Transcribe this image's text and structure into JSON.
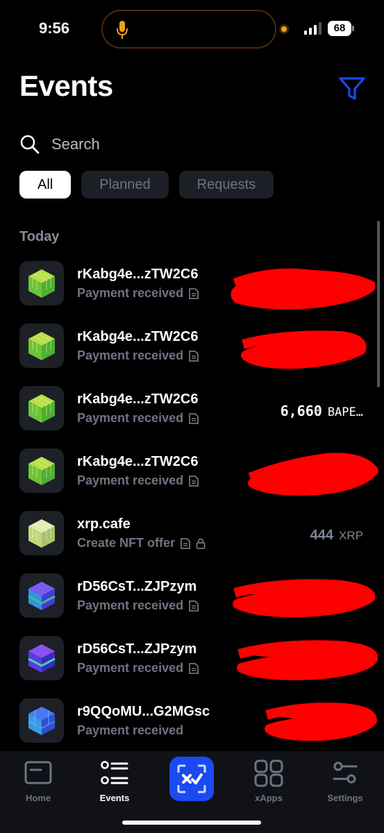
{
  "status_bar": {
    "time": "9:56",
    "battery": "68"
  },
  "header": {
    "title": "Events"
  },
  "search": {
    "placeholder": "Search"
  },
  "filters": [
    {
      "label": "All",
      "active": true
    },
    {
      "label": "Planned",
      "active": false
    },
    {
      "label": "Requests",
      "active": false
    }
  ],
  "section": {
    "label": "Today"
  },
  "events": [
    {
      "name": "rKabg4e...zTW2C6",
      "subtitle": "Payment received",
      "amount": "",
      "currency": "",
      "redacted": true,
      "avatar": "green"
    },
    {
      "name": "rKabg4e...zTW2C6",
      "subtitle": "Payment received",
      "amount": "",
      "currency": "",
      "redacted": true,
      "avatar": "green"
    },
    {
      "name": "rKabg4e...zTW2C6",
      "subtitle": "Payment received",
      "amount": "6,660",
      "currency": "BAPE…",
      "redacted": false,
      "avatar": "green"
    },
    {
      "name": "rKabg4e...zTW2C6",
      "subtitle": "Payment received",
      "amount": "",
      "currency": "",
      "redacted": true,
      "avatar": "green"
    },
    {
      "name": "xrp.cafe",
      "subtitle": "Create NFT offer",
      "amount": "444",
      "currency": "XRP",
      "redacted": false,
      "avatar": "pale",
      "lock": true
    },
    {
      "name": "rD56CsT...ZJPzym",
      "subtitle": "Payment received",
      "amount": "",
      "currency": "",
      "redacted": true,
      "avatar": "purple"
    },
    {
      "name": "rD56CsT...ZJPzym",
      "subtitle": "Payment received",
      "amount": "",
      "currency": "",
      "redacted": true,
      "avatar": "purple"
    },
    {
      "name": "r9QQoMU...G2MGsc",
      "subtitle": "Payment received",
      "amount": "",
      "currency": "",
      "redacted": true,
      "avatar": "blue"
    }
  ],
  "tabbar": {
    "home": "Home",
    "events": "Events",
    "xapps": "xApps",
    "settings": "Settings"
  },
  "colors": {
    "accent": "#1a4af0",
    "redaction": "#ff0000",
    "muted": "#6d7482"
  }
}
